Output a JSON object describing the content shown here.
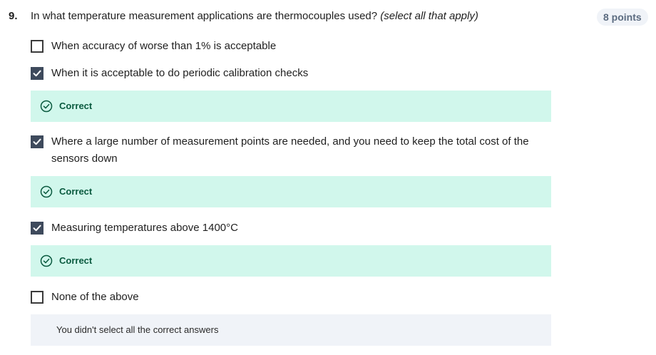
{
  "question": {
    "number": "9.",
    "text": "In what temperature measurement applications are thermocouples used?",
    "hint": "(select all that apply)",
    "points": "8 points"
  },
  "options": [
    {
      "label": "When accuracy of worse than 1% is acceptable",
      "checked": false
    },
    {
      "label": "When it is acceptable to do periodic calibration checks",
      "checked": true,
      "feedback": "Correct"
    },
    {
      "label": "Where a large number of measurement points are needed, and you need to keep the total cost of the sensors down",
      "checked": true,
      "feedback": "Correct"
    },
    {
      "label": "Measuring temperatures above 1400°C",
      "checked": true,
      "feedback": "Correct"
    },
    {
      "label": "None of the above",
      "checked": false
    }
  ],
  "summary_feedback": "You didn't select all the correct answers",
  "colors": {
    "correct_bg": "#d1f7ec",
    "correct_text": "#0a5a3f",
    "checkbox_checked": "#3e4a5c",
    "neutral_bg": "#f0f3f8",
    "badge_text": "#5b6b80"
  },
  "icons": {
    "checkmark": "checkmark-icon",
    "correct": "check-circle-icon"
  }
}
